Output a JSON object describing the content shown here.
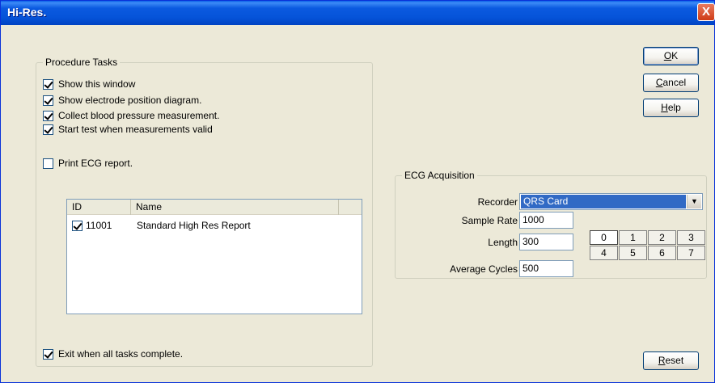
{
  "window": {
    "title": "Hi-Res.",
    "close_glyph": "X"
  },
  "procedure_tasks": {
    "title": "Procedure Tasks",
    "items": [
      {
        "label": "Show this window",
        "checked": true
      },
      {
        "label": "Show electrode position diagram.",
        "checked": true
      },
      {
        "label": "Collect blood pressure measurement.",
        "checked": true
      },
      {
        "label": "Start test when measurements valid",
        "checked": true
      }
    ],
    "print_report": {
      "label": "Print ECG report.",
      "checked": false
    },
    "report_list": {
      "columns": [
        "ID",
        "Name"
      ],
      "rows": [
        {
          "id": "11001",
          "name": "Standard High Res Report",
          "checked": true
        }
      ]
    },
    "exit_when_complete": {
      "label": "Exit when all tasks complete.",
      "checked": true
    }
  },
  "ecg_acquisition": {
    "title": "ECG Acquisition",
    "recorder_label": "Recorder",
    "recorder_value": "QRS Card",
    "sample_rate_label": "Sample Rate",
    "sample_rate_value": "1000",
    "length_label": "Length",
    "length_value": "300",
    "average_cycles_label": "Average Cycles",
    "average_cycles_value": "500",
    "digits_row1": [
      "0",
      "1",
      "2",
      "3"
    ],
    "digits_row2": [
      "4",
      "5",
      "6",
      "7"
    ]
  },
  "buttons": {
    "ok": {
      "mnemonic": "O",
      "rest": "K"
    },
    "cancel": {
      "mnemonic": "C",
      "rest": "ancel"
    },
    "help": {
      "mnemonic": "H",
      "rest": "elp"
    },
    "reset": {
      "mnemonic": "R",
      "rest": "eset"
    }
  },
  "colors": {
    "title_bar": "#0553d8",
    "selection": "#316ac5",
    "dialog_bg": "#ece9d8"
  },
  "icons": {
    "close": "close-icon",
    "dropdown": "chevron-down-icon"
  }
}
